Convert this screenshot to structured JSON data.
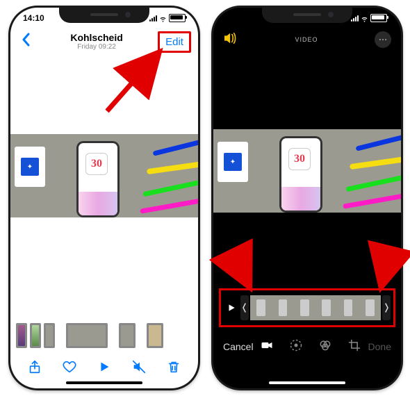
{
  "left_phone": {
    "status": {
      "time": "14:10"
    },
    "header": {
      "title": "Kohlscheid",
      "subtitle": "Friday  09:22",
      "edit_label": "Edit"
    },
    "preview_number": "30"
  },
  "right_phone": {
    "header": {
      "mode_label": "VIDEO"
    },
    "preview_number": "30",
    "footer": {
      "cancel_label": "Cancel",
      "done_label": "Done"
    }
  },
  "annotation": {
    "highlight_color": "#e00000"
  }
}
